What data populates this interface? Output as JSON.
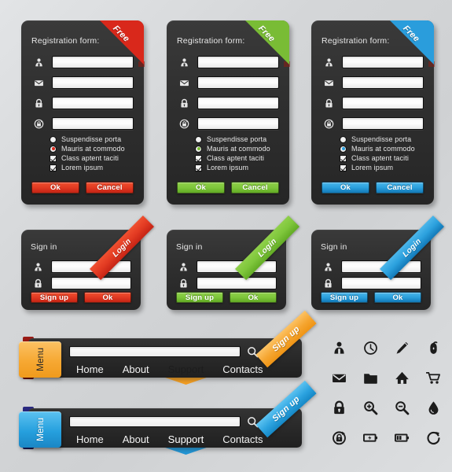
{
  "theme": {
    "red": "#d9281b",
    "green": "#79bc35",
    "blue": "#2a9ddc",
    "orange": "#f8a938",
    "panel_dark": "#2f2f2f",
    "page_bg": "#d6d8da"
  },
  "registration_forms": [
    {
      "ribbon": "Free",
      "color": "red",
      "title": "Registration form:",
      "fields": [
        {
          "icon": "user-icon",
          "value": "",
          "placeholder": ""
        },
        {
          "icon": "envelope-icon",
          "value": "",
          "placeholder": ""
        },
        {
          "icon": "lock-icon",
          "value": "",
          "placeholder": ""
        },
        {
          "icon": "lock-rotate-icon",
          "value": "",
          "placeholder": ""
        }
      ],
      "choices": [
        {
          "type": "radio",
          "label": "Suspendisse porta",
          "checked": false
        },
        {
          "type": "radio",
          "label": "Mauris at commodo",
          "checked": true
        },
        {
          "type": "checkbox",
          "label": "Class aptent taciti",
          "checked": true
        },
        {
          "type": "checkbox",
          "label": "Lorem ipsum",
          "checked": true
        }
      ],
      "buttons": [
        "Ok",
        "Cancel"
      ]
    },
    {
      "ribbon": "Free",
      "color": "green",
      "title": "Registration form:",
      "fields": [
        {
          "icon": "user-icon",
          "value": "",
          "placeholder": ""
        },
        {
          "icon": "envelope-icon",
          "value": "",
          "placeholder": ""
        },
        {
          "icon": "lock-icon",
          "value": "",
          "placeholder": ""
        },
        {
          "icon": "lock-rotate-icon",
          "value": "",
          "placeholder": ""
        }
      ],
      "choices": [
        {
          "type": "radio",
          "label": "Suspendisse porta",
          "checked": false
        },
        {
          "type": "radio",
          "label": "Mauris at commodo",
          "checked": true
        },
        {
          "type": "checkbox",
          "label": "Class aptent taciti",
          "checked": true
        },
        {
          "type": "checkbox",
          "label": "Lorem ipsum",
          "checked": true
        }
      ],
      "buttons": [
        "Ok",
        "Cancel"
      ]
    },
    {
      "ribbon": "Free",
      "color": "blue",
      "title": "Registration form:",
      "fields": [
        {
          "icon": "user-icon",
          "value": "",
          "placeholder": ""
        },
        {
          "icon": "envelope-icon",
          "value": "",
          "placeholder": ""
        },
        {
          "icon": "lock-icon",
          "value": "",
          "placeholder": ""
        },
        {
          "icon": "lock-rotate-icon",
          "value": "",
          "placeholder": ""
        }
      ],
      "choices": [
        {
          "type": "radio",
          "label": "Suspendisse porta",
          "checked": false
        },
        {
          "type": "radio",
          "label": "Mauris at commodo",
          "checked": true
        },
        {
          "type": "checkbox",
          "label": "Class aptent taciti",
          "checked": true
        },
        {
          "type": "checkbox",
          "label": "Lorem ipsum",
          "checked": true
        }
      ],
      "buttons": [
        "Ok",
        "Cancel"
      ]
    }
  ],
  "signin_panels": [
    {
      "ribbon": "Login",
      "color": "red",
      "title": "Sign in",
      "fields": [
        {
          "icon": "user-icon",
          "value": ""
        },
        {
          "icon": "lock-icon",
          "value": ""
        }
      ],
      "buttons": [
        "Sign up",
        "Ok"
      ]
    },
    {
      "ribbon": "Login",
      "color": "green",
      "title": "Sign in",
      "fields": [
        {
          "icon": "user-icon",
          "value": ""
        },
        {
          "icon": "lock-icon",
          "value": ""
        }
      ],
      "buttons": [
        "Sign up",
        "Ok"
      ]
    },
    {
      "ribbon": "Login",
      "color": "blue",
      "title": "Sign in",
      "fields": [
        {
          "icon": "user-icon",
          "value": ""
        },
        {
          "icon": "lock-icon",
          "value": ""
        }
      ],
      "buttons": [
        "Sign up",
        "Ok"
      ]
    }
  ],
  "navbars": [
    {
      "color": "orange",
      "menu_label": "Menu",
      "signup_label": "Sign up",
      "search": {
        "value": "",
        "placeholder": "",
        "icon": "search-icon"
      },
      "links": [
        {
          "label": "Home",
          "active": false
        },
        {
          "label": "About",
          "active": false
        },
        {
          "label": "Support",
          "active": true
        },
        {
          "label": "Contacts",
          "active": false
        }
      ]
    },
    {
      "color": "blue",
      "menu_label": "Menu",
      "signup_label": "Sign up",
      "search": {
        "value": "",
        "placeholder": "",
        "icon": "search-icon"
      },
      "links": [
        {
          "label": "Home",
          "active": false
        },
        {
          "label": "About",
          "active": false
        },
        {
          "label": "Support",
          "active": true
        },
        {
          "label": "Contacts",
          "active": false
        }
      ]
    }
  ],
  "icon_grid": [
    "user-icon",
    "clock-icon",
    "pencil-icon",
    "mouse-icon",
    "envelope-icon",
    "folder-icon",
    "home-icon",
    "cart-icon",
    "lock-icon",
    "zoom-in-icon",
    "zoom-out-icon",
    "droplet-icon",
    "lock-rotate-icon",
    "battery-charging-icon",
    "battery-half-icon",
    "refresh-icon"
  ]
}
